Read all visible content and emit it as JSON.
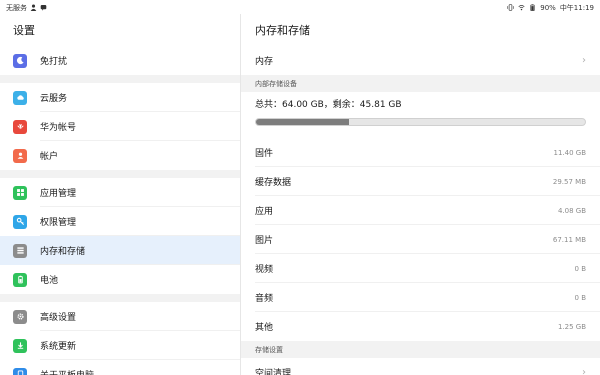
{
  "statusbar": {
    "carrier": "无服务",
    "battery": "90%",
    "time": "中午11:19"
  },
  "settings": {
    "title": "设置",
    "groups": [
      [
        {
          "label": "免打扰",
          "icon": "moon-icon",
          "color": "#5b6ee6"
        }
      ],
      [
        {
          "label": "云服务",
          "icon": "cloud-icon",
          "color": "#3cb0e8"
        },
        {
          "label": "华为帐号",
          "icon": "huawei-logo-icon",
          "color": "#e8483c"
        },
        {
          "label": "帐户",
          "icon": "account-icon",
          "color": "#f26a4b"
        }
      ],
      [
        {
          "label": "应用管理",
          "icon": "apps-icon",
          "color": "#2fc25b"
        },
        {
          "label": "权限管理",
          "icon": "key-icon",
          "color": "#2fa6e8"
        },
        {
          "label": "内存和存储",
          "icon": "storage-icon",
          "color": "#8c8c8c"
        },
        {
          "label": "电池",
          "icon": "battery-icon",
          "color": "#2fc25b"
        }
      ],
      [
        {
          "label": "高级设置",
          "icon": "gear-icon",
          "color": "#8c8c8c"
        },
        {
          "label": "系统更新",
          "icon": "update-icon",
          "color": "#2fc25b"
        },
        {
          "label": "关于平板电脑",
          "icon": "tablet-icon",
          "color": "#2f8ce8"
        }
      ]
    ],
    "active": "内存和存储"
  },
  "storage": {
    "title": "内存和存储",
    "memory_label": "内存",
    "internal_section": "内部存储设备",
    "total_line": "总共：64.00 GB，剩余：45.81 GB",
    "used_fraction": 0.284,
    "items": [
      {
        "label": "固件",
        "value": "11.40 GB"
      },
      {
        "label": "缓存数据",
        "value": "29.57 MB"
      },
      {
        "label": "应用",
        "value": "4.08 GB"
      },
      {
        "label": "图片",
        "value": "67.11 MB"
      },
      {
        "label": "视频",
        "value": "0 B"
      },
      {
        "label": "音频",
        "value": "0 B"
      },
      {
        "label": "其他",
        "value": "1.25 GB"
      }
    ],
    "settings_section": "存储设置",
    "cleanup_label": "空间清理"
  },
  "colors": {
    "active_bg": "#e6f0fc",
    "bar_fill": "#7d7d7d"
  }
}
